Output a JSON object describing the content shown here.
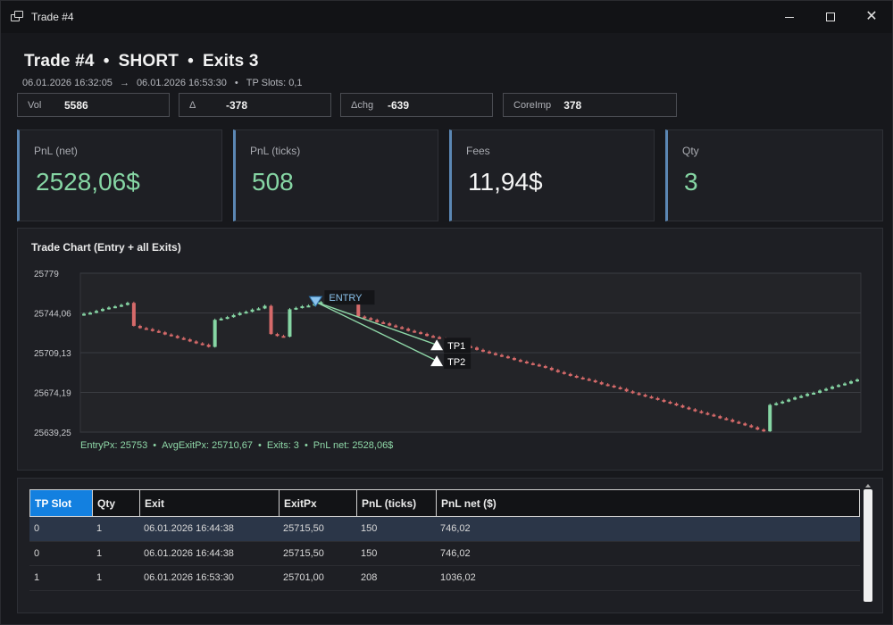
{
  "window": {
    "title": "Trade #4"
  },
  "header": {
    "title_trade": "Trade #4",
    "title_side": "SHORT",
    "title_exits": "Exits 3",
    "time_from": "06.01.2026 16:32:05",
    "arrow": "→",
    "time_to": "06.01.2026 16:53:30",
    "tp_slots": "TP Slots: 0,1"
  },
  "stats": [
    {
      "label": "Vol",
      "value": "5586"
    },
    {
      "label": "Δ",
      "value": "-378"
    },
    {
      "label": "Δchg",
      "value": "-639"
    },
    {
      "label": "CoreImp",
      "value": "378"
    }
  ],
  "cards": [
    {
      "label": "PnL (net)",
      "value": "2528,06$",
      "color": "#86d6a4"
    },
    {
      "label": "PnL (ticks)",
      "value": "508",
      "color": "#86d6a4"
    },
    {
      "label": "Fees",
      "value": "11,94$",
      "color": "#f4f4f4"
    },
    {
      "label": "Qty",
      "value": "3",
      "color": "#86d6a4"
    }
  ],
  "chart": {
    "title": "Trade Chart (Entry + all Exits)",
    "summary": {
      "entry_px": "EntryPx: 25753",
      "avg_exit_px": "AvgExitPx: 25710,67",
      "exits": "Exits: 3",
      "pnl_net": "PnL net: 2528,06$"
    }
  },
  "chart_data": {
    "type": "candlestick",
    "y_ticks": [
      "25779",
      "25744,06",
      "25709,13",
      "25674,19",
      "25639,25"
    ],
    "ylim": [
      25639.25,
      25779
    ],
    "grid": true,
    "up_color": "#86d6a4",
    "down_color": "#d66a6a",
    "closes": [
      25743.3,
      25744.2,
      25745.8,
      25747.5,
      25748.8,
      25749.8,
      25751.1,
      25752.9,
      25732.7,
      25730.7,
      25729.8,
      25728.2,
      25727,
      25725.1,
      25723.8,
      25722,
      25720.8,
      25719,
      25717.3,
      25716.1,
      25714.2,
      25738,
      25739.1,
      25740.4,
      25742.2,
      25744,
      25745.1,
      25747,
      25748,
      25750.3,
      25725.5,
      25723.8,
      25723.2,
      25747.3,
      25748.5,
      25749.9,
      25750.5,
      25752.3,
      25753.6,
      25754.4,
      25755.6,
      25757.5,
      25758.9,
      25760.5,
      25740.9,
      25739.5,
      25738,
      25735.9,
      25734.9,
      25733,
      25731.6,
      25730.2,
      25728.3,
      25727.1,
      25725.7,
      25723.8,
      25722.8,
      25721.5,
      25719.7,
      25718.3,
      25716.7,
      25714.8,
      25713.6,
      25711.6,
      25710.1,
      25708.6,
      25707.1,
      25705.8,
      25704.4,
      25702.7,
      25701.3,
      25699.8,
      25698.6,
      25697.3,
      25695.8,
      25693.8,
      25692,
      25690.4,
      25688.7,
      25687.2,
      25686,
      25684.7,
      25683.1,
      25681.3,
      25680.1,
      25678.6,
      25677.2,
      25675.1,
      25673.5,
      25672.1,
      25670.5,
      25669.2,
      25667.6,
      25665.9,
      25664.4,
      25662.7,
      25660.9,
      25659.3,
      25657.6,
      25656.1,
      25654.6,
      25653.3,
      25651.4,
      25650.2,
      25648.3,
      25646.9,
      25645.2,
      25643.5,
      25641.5,
      25640,
      25663.2,
      25664.6,
      25666.1,
      25667.9,
      25669.7,
      25671,
      25672.9,
      25673.8,
      25675.8,
      25677.3,
      25679.2,
      25680.6,
      25682,
      25683.9,
      25685.5
    ],
    "entry": {
      "price": 25753,
      "label": "ENTRY"
    },
    "exits": [
      {
        "label": "TP1",
        "price": 25716
      },
      {
        "label": "TP2",
        "price": 25702
      }
    ]
  },
  "table": {
    "columns": [
      "TP Slot",
      "Qty",
      "Exit",
      "ExitPx",
      "PnL (ticks)",
      "PnL net ($)"
    ],
    "rows": [
      [
        "0",
        "1",
        "06.01.2026 16:44:38",
        "25715,50",
        "150",
        "746,02"
      ],
      [
        "0",
        "1",
        "06.01.2026 16:44:38",
        "25715,50",
        "150",
        "746,02"
      ],
      [
        "1",
        "1",
        "06.01.2026 16:53:30",
        "25701,00",
        "208",
        "1036,02"
      ]
    ]
  }
}
